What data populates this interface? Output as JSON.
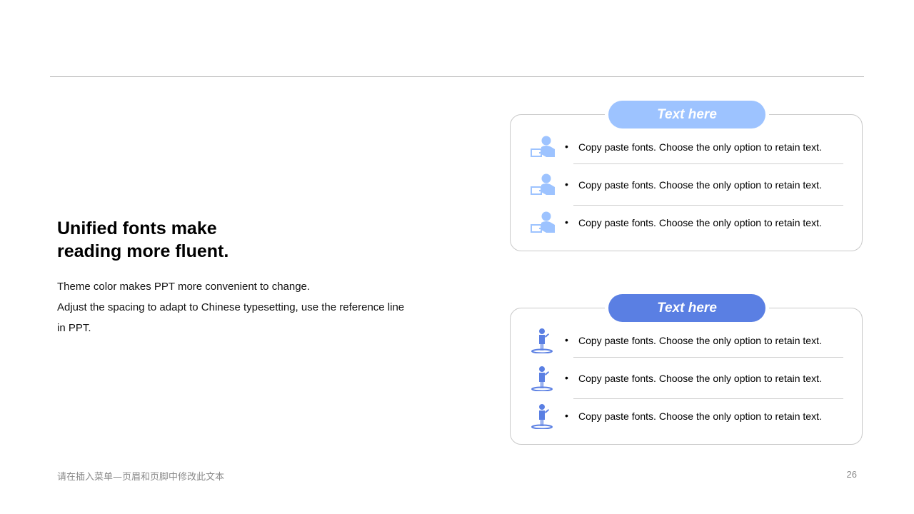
{
  "left": {
    "heading_lines": [
      "Unified fonts make",
      "reading more fluent."
    ],
    "body_lines": [
      "Theme color makes PPT more convenient to change.",
      "Adjust the spacing to adapt to Chinese typesetting, use the reference line",
      "in PPT."
    ]
  },
  "cards": [
    {
      "title": "Text here",
      "color": "#9dc3ff",
      "icon": "presenter-icon",
      "items": [
        "Copy paste fonts. Choose the only option to retain text.",
        "Copy paste fonts. Choose the only option to retain text.",
        "Copy paste fonts. Choose the only option to retain text."
      ]
    },
    {
      "title": "Text here",
      "color": "#5a7fe3",
      "icon": "standing-person-icon",
      "items": [
        "Copy paste fonts. Choose the only option to retain text.",
        "Copy paste fonts. Choose the only option to retain text.",
        "Copy paste fonts. Choose the only option to retain text."
      ]
    }
  ],
  "bullet_symbol": "•",
  "footer": {
    "text": "请在插入菜单—页眉和页脚中修改此文本",
    "page_number": "26"
  }
}
